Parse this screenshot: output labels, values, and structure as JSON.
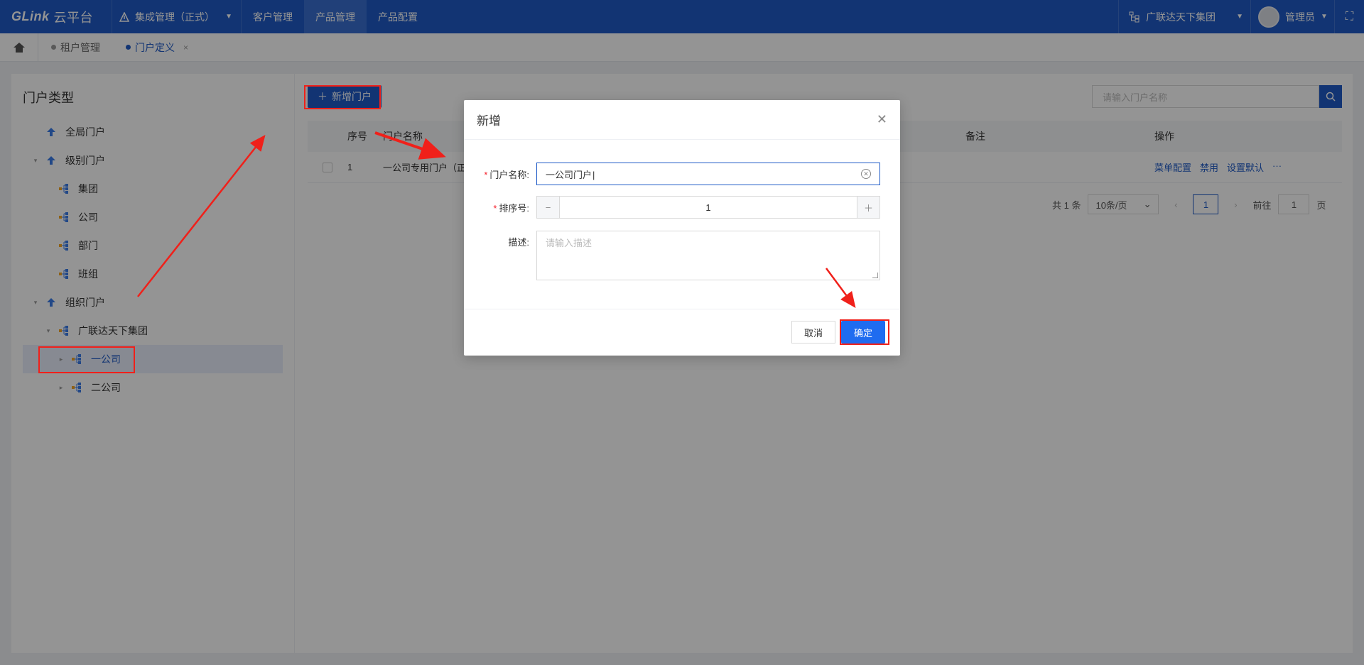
{
  "topbar": {
    "logo": "GLink",
    "logo_suffix": "云平台",
    "system_name": "集成管理（正式）",
    "nav": [
      "客户管理",
      "产品管理",
      "产品配置"
    ],
    "active_nav": "产品管理",
    "org_name": "广联达天下集团",
    "user_name": "管理员"
  },
  "tabs": [
    {
      "label": "租户管理",
      "active": false
    },
    {
      "label": "门户定义",
      "active": true
    }
  ],
  "left": {
    "title": "门户类型",
    "tree": [
      {
        "label": "全局门户",
        "level": 0,
        "expander": "",
        "icon": "up-icon"
      },
      {
        "label": "级别门户",
        "level": 0,
        "expander": "▾",
        "icon": "up-icon"
      },
      {
        "label": "集团",
        "level": 1,
        "expander": "",
        "icon": "org-icon"
      },
      {
        "label": "公司",
        "level": 1,
        "expander": "",
        "icon": "org-icon"
      },
      {
        "label": "部门",
        "level": 1,
        "expander": "",
        "icon": "org-icon"
      },
      {
        "label": "班组",
        "level": 1,
        "expander": "",
        "icon": "org-icon"
      },
      {
        "label": "组织门户",
        "level": 0,
        "expander": "▾",
        "icon": "up-icon"
      },
      {
        "label": "广联达天下集团",
        "level": 1,
        "expander": "▾",
        "icon": "org-icon"
      },
      {
        "label": "一公司",
        "level": 2,
        "expander": "▸",
        "icon": "org-icon",
        "selected": true
      },
      {
        "label": "二公司",
        "level": 2,
        "expander": "▸",
        "icon": "org-icon"
      }
    ]
  },
  "main": {
    "add_button": "新增门户",
    "search_placeholder": "请输入门户名称",
    "columns": [
      "序号",
      "门户名称",
      "备注",
      "操作"
    ],
    "rows": [
      {
        "index": "1",
        "name": "一公司专用门户（正式）",
        "remark": "",
        "actions": [
          "菜单配置",
          "禁用",
          "设置默认",
          "···"
        ]
      }
    ],
    "pager": {
      "total": "共 1 条",
      "page_size": "10条/页",
      "current": "1",
      "goto_label": "前往",
      "goto_value": "1",
      "page_suffix": "页"
    }
  },
  "dialog": {
    "title": "新增",
    "name_label": "门户名称:",
    "name_value": "一公司门户",
    "order_label": "排序号:",
    "order_value": "1",
    "desc_label": "描述:",
    "desc_placeholder": "请输入描述",
    "cancel": "取消",
    "ok": "确定"
  },
  "colors": {
    "primary": "#1f5bc7",
    "annotation": "#f0201a",
    "ok_button": "#1f6cf0"
  }
}
